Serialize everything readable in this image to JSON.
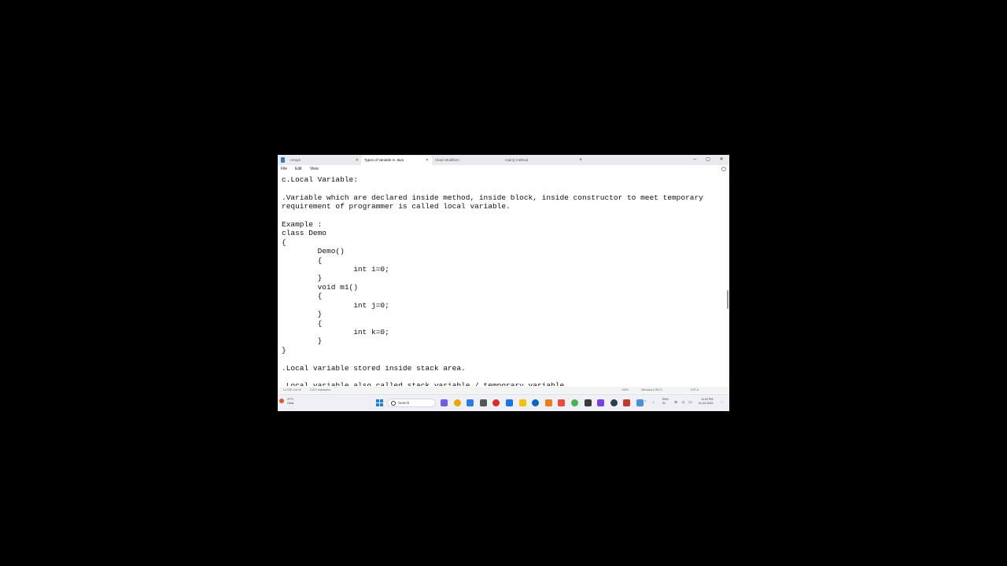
{
  "tabs": [
    {
      "label": "Arrays",
      "active": false
    },
    {
      "label": "Types of Variable in Java",
      "active": true
    },
    {
      "label": "Class Modifiers",
      "active": false
    },
    {
      "label": "main() method",
      "active": false
    }
  ],
  "new_tab_label": "+",
  "window_controls": {
    "minimize": "─",
    "maximize": "▢",
    "close": "✕"
  },
  "menu": {
    "file": "File",
    "edit": "Edit",
    "view": "View"
  },
  "editor_text": "c.Local Variable:\n\n.Variable which are declared inside method, inside block, inside constructor to meet temporary\nrequirement of programmer is called local variable.\n\nExample :\nclass Demo\n{\n\tDemo()\n\t{\n\t\tint i=0;\n\t}\n\tvoid m1()\n\t{\n\t\tint j=0;\n\t}\n\t{\n\t\tint k=0;\n\t}\n}\n\n.Local variable stored inside stack area.\n\n.Local variable also called stack variable / temporary variable",
  "status": {
    "position": "Ln 106, Col 16",
    "characters": "2,874 characters",
    "zoom": "100%",
    "line_ending": "Windows (CRLF)",
    "encoding": "UTF-8"
  },
  "taskbar": {
    "weather_temp": "27°C",
    "weather_desc": "Clear",
    "search_placeholder": "Search",
    "language_line1": "ENG",
    "language_line2": "IN",
    "time": "11:32 PM",
    "date": "01-02-2024"
  },
  "colors": {
    "accent": "#1e7ee0",
    "taskbar_icons": [
      "#6c5ce7",
      "#f0a500",
      "#2b7de9",
      "#555555",
      "#d93025",
      "#1a73e8",
      "#f4c20d",
      "#0a66c2",
      "#e67e22",
      "#e74c3c",
      "#4caf50",
      "#3a3a3a",
      "#7b3fe4",
      "#2c3e50",
      "#c0392b",
      "#4a90d9"
    ]
  }
}
